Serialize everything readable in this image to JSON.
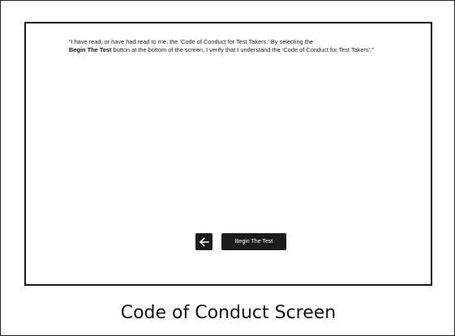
{
  "screen": {
    "statement_part1": "“I have read, or have had read to me, the ‘Code of Conduct for Test Takers.’ By selecting the",
    "statement_bold": "Begin The Test",
    "statement_part2": " button at the bottom of the screen, I verify that I understand the ‘Code of Conduct for Test Takers’.”",
    "back_icon": "arrow-left-icon",
    "begin_label": "Begin The Test"
  },
  "caption": "Code of Conduct Screen"
}
